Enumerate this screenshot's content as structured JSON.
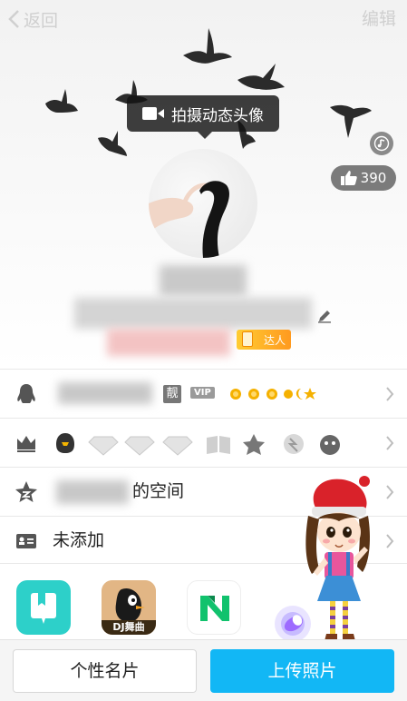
{
  "nav": {
    "back_label": "返回",
    "edit_label": "编辑"
  },
  "header": {
    "tooltip_label": "拍摄动态头像",
    "like_count": "390",
    "talent_badge": "达人"
  },
  "rows": [
    {
      "name": "qq-row",
      "icon": "penguin-icon",
      "hao_badge": "靓",
      "vip_badge": "VIP"
    },
    {
      "name": "privilege-row",
      "icon": "crown-icon"
    },
    {
      "name": "qzone-row",
      "icon": "qzone-star-icon",
      "label": "的空间"
    },
    {
      "name": "card-row",
      "icon": "id-card-icon",
      "label": "未添加"
    }
  ],
  "apps": [
    {
      "name": "app-reader-icon",
      "color": "#2dd0c9"
    },
    {
      "name": "app-dj-music-icon",
      "label": "DJ舞曲",
      "color": "#3a2a14"
    },
    {
      "name": "app-n-icon",
      "color": "#ffffff"
    }
  ],
  "buttons": {
    "card_label": "个性名片",
    "upload_label": "上传照片"
  },
  "colors": {
    "accent": "#12b7f5",
    "talent": "#ff9a1f"
  }
}
